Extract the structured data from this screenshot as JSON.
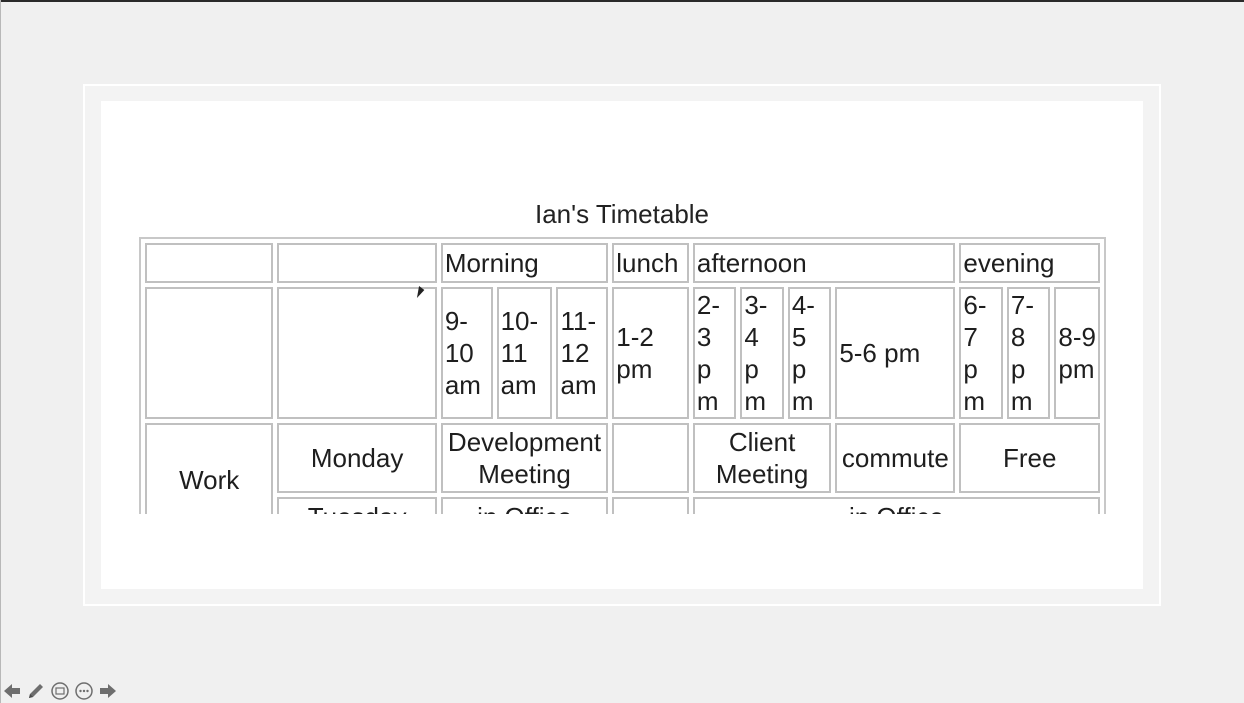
{
  "slide": {
    "title": "Ian's Timetable",
    "table": {
      "header_row1": {
        "blank1": "",
        "blank2": "",
        "morning": "Morning",
        "lunch": "lunch",
        "afternoon": "afternoon",
        "evening": "evening"
      },
      "header_row2": {
        "t1": "9-10 am",
        "t2": "10-11 am",
        "t3": "11-12 am",
        "t4": "1-2 pm",
        "t5": "2-3 pm",
        "t6": "3-4 pm",
        "t7": "4-5 pm",
        "t8": "5-6 pm",
        "t9": "6-7 pm",
        "t10": "7-8 pm",
        "t11": "8-9 pm"
      },
      "row_monday": {
        "category": "Work",
        "day": "Monday",
        "morning": "Development Meeting",
        "lunch": "",
        "afternoon": "Client Meeting",
        "five_six": "commute",
        "evening": "Free"
      },
      "row_tuesday": {
        "day": "Tuesday",
        "morning": "in Office",
        "lunch": "",
        "afternoon": "in Office"
      }
    }
  },
  "toolbar": {
    "icons": [
      "arrow-left-icon",
      "pen-icon",
      "slides-icon",
      "more-icon",
      "arrow-right-icon"
    ]
  }
}
